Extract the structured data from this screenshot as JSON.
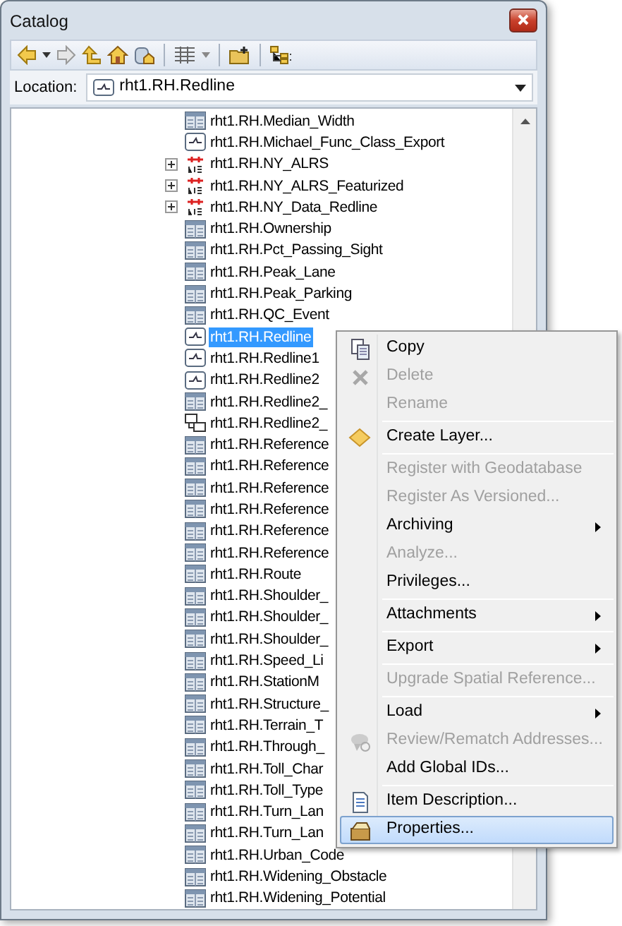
{
  "window": {
    "title": "Catalog"
  },
  "location": {
    "label": "Location:",
    "value": "rht1.RH.Redline"
  },
  "tree": {
    "items": [
      {
        "label": "rht1.RH.Median_Width",
        "kind": "table",
        "has_children": false,
        "selected": false
      },
      {
        "label": "rht1.RH.Michael_Func_Class_Export",
        "kind": "line",
        "has_children": false,
        "selected": false
      },
      {
        "label": "rht1.RH.NY_ALRS",
        "kind": "lrs",
        "has_children": true,
        "selected": false
      },
      {
        "label": "rht1.RH.NY_ALRS_Featurized",
        "kind": "lrs",
        "has_children": true,
        "selected": false
      },
      {
        "label": "rht1.RH.NY_Data_Redline",
        "kind": "lrs",
        "has_children": true,
        "selected": false
      },
      {
        "label": "rht1.RH.Ownership",
        "kind": "table",
        "has_children": false,
        "selected": false
      },
      {
        "label": "rht1.RH.Pct_Passing_Sight",
        "kind": "table",
        "has_children": false,
        "selected": false
      },
      {
        "label": "rht1.RH.Peak_Lane",
        "kind": "table",
        "has_children": false,
        "selected": false
      },
      {
        "label": "rht1.RH.Peak_Parking",
        "kind": "table",
        "has_children": false,
        "selected": false
      },
      {
        "label": "rht1.RH.QC_Event",
        "kind": "table",
        "has_children": false,
        "selected": false
      },
      {
        "label": "rht1.RH.Redline",
        "kind": "line",
        "has_children": false,
        "selected": true
      },
      {
        "label": "rht1.RH.Redline1",
        "kind": "line",
        "has_children": false,
        "selected": false
      },
      {
        "label": "rht1.RH.Redline2",
        "kind": "line",
        "has_children": false,
        "selected": false
      },
      {
        "label": "rht1.RH.Redline2_",
        "kind": "table",
        "has_children": false,
        "selected": false
      },
      {
        "label": "rht1.RH.Redline2_",
        "kind": "relationship",
        "has_children": false,
        "selected": false
      },
      {
        "label": "rht1.RH.Reference",
        "kind": "table",
        "has_children": false,
        "selected": false
      },
      {
        "label": "rht1.RH.Reference",
        "kind": "table",
        "has_children": false,
        "selected": false
      },
      {
        "label": "rht1.RH.Reference",
        "kind": "table",
        "has_children": false,
        "selected": false
      },
      {
        "label": "rht1.RH.Reference",
        "kind": "table",
        "has_children": false,
        "selected": false
      },
      {
        "label": "rht1.RH.Reference",
        "kind": "table",
        "has_children": false,
        "selected": false
      },
      {
        "label": "rht1.RH.Reference",
        "kind": "table",
        "has_children": false,
        "selected": false
      },
      {
        "label": "rht1.RH.Route",
        "kind": "table",
        "has_children": false,
        "selected": false
      },
      {
        "label": "rht1.RH.Shoulder_",
        "kind": "table",
        "has_children": false,
        "selected": false
      },
      {
        "label": "rht1.RH.Shoulder_",
        "kind": "table",
        "has_children": false,
        "selected": false
      },
      {
        "label": "rht1.RH.Shoulder_",
        "kind": "table",
        "has_children": false,
        "selected": false
      },
      {
        "label": "rht1.RH.Speed_Li",
        "kind": "table",
        "has_children": false,
        "selected": false
      },
      {
        "label": "rht1.RH.StationM",
        "kind": "table",
        "has_children": false,
        "selected": false
      },
      {
        "label": "rht1.RH.Structure_",
        "kind": "table",
        "has_children": false,
        "selected": false
      },
      {
        "label": "rht1.RH.Terrain_T",
        "kind": "table",
        "has_children": false,
        "selected": false
      },
      {
        "label": "rht1.RH.Through_",
        "kind": "table",
        "has_children": false,
        "selected": false
      },
      {
        "label": "rht1.RH.Toll_Char",
        "kind": "table",
        "has_children": false,
        "selected": false
      },
      {
        "label": "rht1.RH.Toll_Type",
        "kind": "table",
        "has_children": false,
        "selected": false
      },
      {
        "label": "rht1.RH.Turn_Lan",
        "kind": "table",
        "has_children": false,
        "selected": false
      },
      {
        "label": "rht1.RH.Turn_Lan",
        "kind": "table",
        "has_children": false,
        "selected": false
      },
      {
        "label": "rht1.RH.Urban_Code",
        "kind": "table",
        "has_children": false,
        "selected": false
      },
      {
        "label": "rht1.RH.Widening_Obstacle",
        "kind": "table",
        "has_children": false,
        "selected": false
      },
      {
        "label": "rht1.RH.Widening_Potential",
        "kind": "table",
        "has_children": false,
        "selected": false
      }
    ]
  },
  "context_menu": {
    "items": [
      {
        "kind": "item",
        "label": "Copy",
        "disabled": false,
        "submenu": false,
        "selected": false
      },
      {
        "kind": "item",
        "label": "Delete",
        "disabled": true,
        "submenu": false,
        "selected": false
      },
      {
        "kind": "item",
        "label": "Rename",
        "disabled": true,
        "submenu": false,
        "selected": false
      },
      {
        "kind": "separator"
      },
      {
        "kind": "item",
        "label": "Create Layer...",
        "disabled": false,
        "submenu": false,
        "selected": false
      },
      {
        "kind": "separator"
      },
      {
        "kind": "item",
        "label": "Register with Geodatabase",
        "disabled": true,
        "submenu": false,
        "selected": false
      },
      {
        "kind": "item",
        "label": "Register As Versioned...",
        "disabled": true,
        "submenu": false,
        "selected": false
      },
      {
        "kind": "item",
        "label": "Archiving",
        "disabled": false,
        "submenu": true,
        "selected": false
      },
      {
        "kind": "item",
        "label": "Analyze...",
        "disabled": true,
        "submenu": false,
        "selected": false
      },
      {
        "kind": "item",
        "label": "Privileges...",
        "disabled": false,
        "submenu": false,
        "selected": false
      },
      {
        "kind": "separator"
      },
      {
        "kind": "item",
        "label": "Attachments",
        "disabled": false,
        "submenu": true,
        "selected": false
      },
      {
        "kind": "separator"
      },
      {
        "kind": "item",
        "label": "Export",
        "disabled": false,
        "submenu": true,
        "selected": false
      },
      {
        "kind": "separator"
      },
      {
        "kind": "item",
        "label": "Upgrade Spatial Reference...",
        "disabled": true,
        "submenu": false,
        "selected": false
      },
      {
        "kind": "separator"
      },
      {
        "kind": "item",
        "label": "Load",
        "disabled": false,
        "submenu": true,
        "selected": false
      },
      {
        "kind": "item",
        "label": "Review/Rematch Addresses...",
        "disabled": true,
        "submenu": false,
        "selected": false
      },
      {
        "kind": "item",
        "label": "Add Global IDs...",
        "disabled": false,
        "submenu": false,
        "selected": false
      },
      {
        "kind": "separator"
      },
      {
        "kind": "item",
        "label": "Item Description...",
        "disabled": false,
        "submenu": false,
        "selected": false
      },
      {
        "kind": "item",
        "label": "Properties...",
        "disabled": false,
        "submenu": false,
        "selected": true
      }
    ]
  }
}
